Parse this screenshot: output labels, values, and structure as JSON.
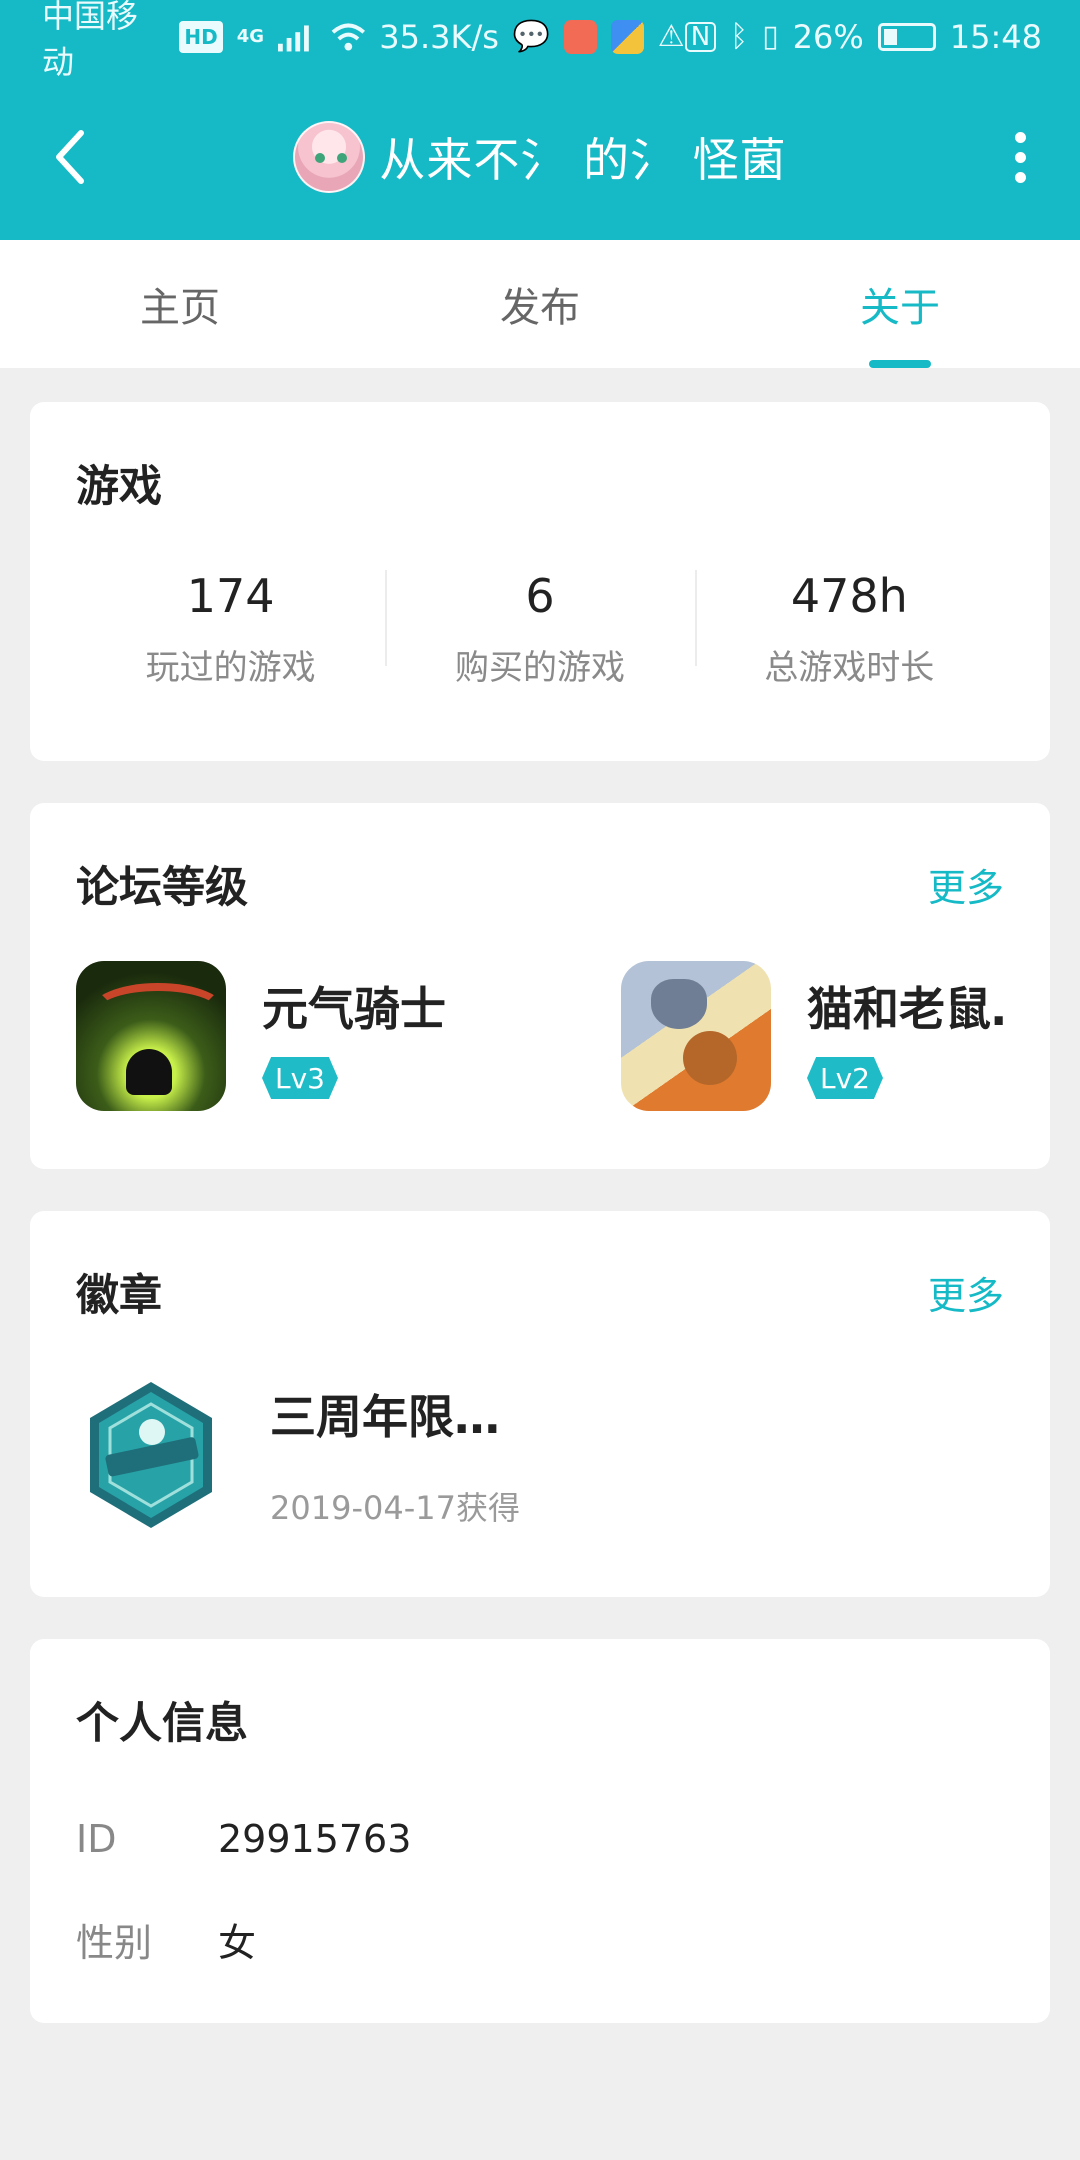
{
  "status_bar": {
    "carrier": "中国移动",
    "hd": "HD",
    "network": "4G",
    "speed": "35.3K/s",
    "battery": "26%",
    "time": "15:48"
  },
  "header": {
    "nickname": "从来不氵 的氵 怪菌"
  },
  "tabs": [
    {
      "label": "主页",
      "active": false
    },
    {
      "label": "发布",
      "active": false
    },
    {
      "label": "关于",
      "active": true
    }
  ],
  "games_card": {
    "title": "游戏",
    "stats": [
      {
        "value": "174",
        "label": "玩过的游戏"
      },
      {
        "value": "6",
        "label": "购买的游戏"
      },
      {
        "value": "478h",
        "label": "总游戏时长"
      }
    ]
  },
  "forum_card": {
    "title": "论坛等级",
    "more": "更多",
    "items": [
      {
        "name": "元气骑士",
        "level": "Lv3"
      },
      {
        "name": "猫和老鼠…",
        "level": "Lv2"
      }
    ]
  },
  "badge_card": {
    "title": "徽章",
    "more": "更多",
    "items": [
      {
        "name": "三周年限…",
        "date": "2019-04-17获得"
      }
    ]
  },
  "info_card": {
    "title": "个人信息",
    "rows": [
      {
        "key": "ID",
        "value": "29915763"
      },
      {
        "key": "性别",
        "value": "女"
      }
    ]
  },
  "colors": {
    "accent": "#16b9c6",
    "background": "#efefef"
  }
}
